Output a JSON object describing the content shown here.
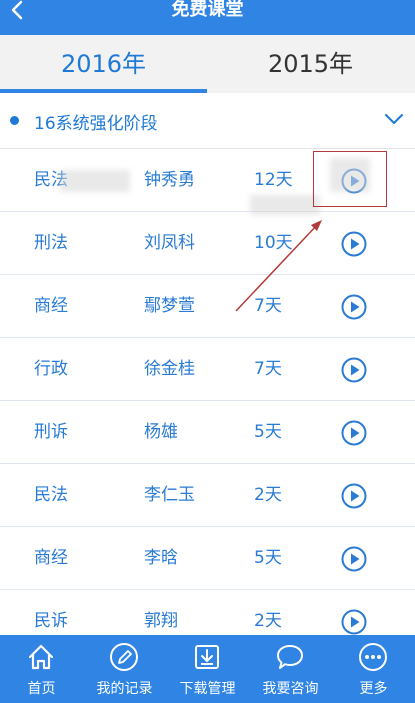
{
  "header": {
    "title": "免费课堂",
    "back_icon": "back-arrow-icon"
  },
  "tabs": [
    {
      "label": "2016年",
      "active": true
    },
    {
      "label": "2015年",
      "active": false
    }
  ],
  "section": {
    "title": "16系统强化阶段",
    "expand_icon": "chevron-down-icon"
  },
  "courses": [
    {
      "subject": "民法",
      "teacher": "钟秀勇",
      "days": "12天"
    },
    {
      "subject": "刑法",
      "teacher": "刘凤科",
      "days": "10天"
    },
    {
      "subject": "商经",
      "teacher": "鄢梦萱",
      "days": "7天"
    },
    {
      "subject": "行政",
      "teacher": "徐金桂",
      "days": "7天"
    },
    {
      "subject": "刑诉",
      "teacher": "杨雄",
      "days": "5天"
    },
    {
      "subject": "民法",
      "teacher": "李仁玉",
      "days": "2天"
    },
    {
      "subject": "商经",
      "teacher": "李晗",
      "days": "5天"
    },
    {
      "subject": "民诉",
      "teacher": "郭翔",
      "days": "2天"
    }
  ],
  "bottom_nav": [
    {
      "label": "首页",
      "icon": "home-icon"
    },
    {
      "label": "我的记录",
      "icon": "pencil-icon"
    },
    {
      "label": "下载管理",
      "icon": "download-icon"
    },
    {
      "label": "我要咨询",
      "icon": "chat-bubble-icon"
    },
    {
      "label": "更多",
      "icon": "more-icon"
    }
  ],
  "colors": {
    "primary": "#2f84e4",
    "text_blue": "#2a7bd4",
    "annotation_red": "#b23a3a"
  }
}
